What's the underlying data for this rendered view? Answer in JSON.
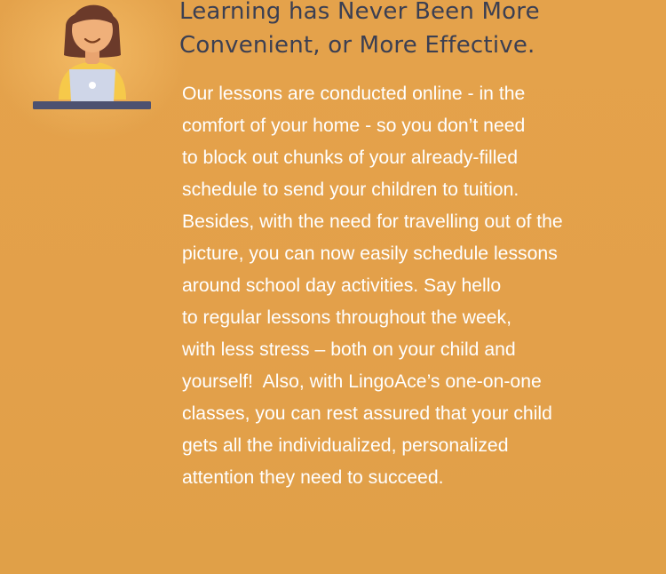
{
  "heading": {
    "line1": "Learning has Never Been More",
    "line2": "Convenient, or More Effective."
  },
  "body_lines": [
    "Our lessons are conducted online - in the",
    "comfort of your home - so you don’t need",
    "to block out chunks of your already-filled",
    "schedule to send your children to tuition.",
    "Besides, with the need for travelling out of the",
    "picture, you can now easily schedule lessons",
    "around school day activities. Say hello",
    "to regular lessons throughout the week,",
    "with less stress – both on your child and",
    "yourself!  Also, with LingoAce’s one-on-one",
    "classes, you can rest assured that your child",
    "gets all the individualized, personalized",
    "attention they need to succeed."
  ],
  "illustration": {
    "icon": "student-with-laptop-icon"
  },
  "colors": {
    "background": "#e3a14a",
    "heading": "#3b3f52",
    "body_text": "#ffffff",
    "laptop": "#cfd6e8",
    "desk": "#4d5170",
    "shirt": "#f6c94a",
    "hair": "#6b3a2a",
    "skin": "#f0b07a"
  }
}
